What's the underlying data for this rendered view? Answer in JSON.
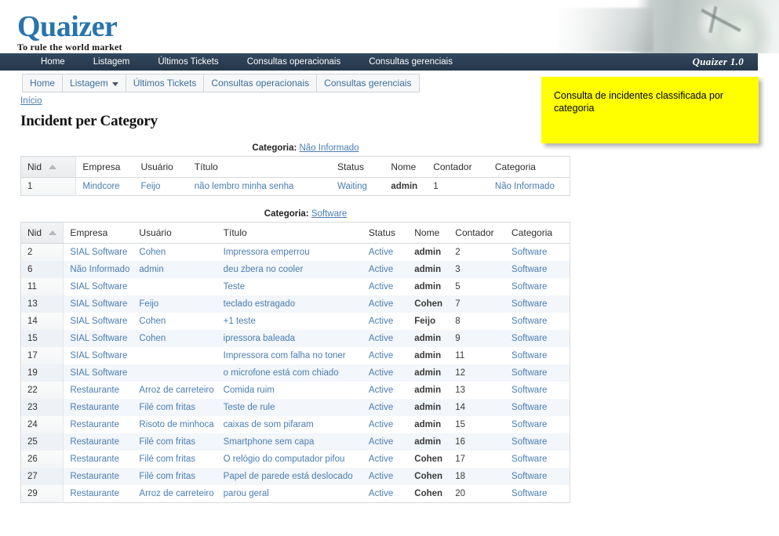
{
  "brand": {
    "logo": "Quaizer",
    "tagline": "To rule the world market",
    "version": "Quaizer 1.0",
    "logo_color": "#2874ab",
    "nav_bg": "#2b3e53"
  },
  "primary_nav": [
    {
      "label": "Home"
    },
    {
      "label": "Listagem"
    },
    {
      "label": "Últimos Tickets"
    },
    {
      "label": "Consultas operacionais"
    },
    {
      "label": "Consultas gerenciais"
    }
  ],
  "secondary_nav": [
    {
      "label": "Home",
      "caret": false
    },
    {
      "label": "Listagem",
      "caret": true
    },
    {
      "label": "Últimos Tickets",
      "caret": false
    },
    {
      "label": "Consultas operacionais",
      "caret": false
    },
    {
      "label": "Consultas gerenciais",
      "caret": false
    }
  ],
  "breadcrumb": "Início",
  "page_title": "Incident per Category",
  "callout": {
    "text": "Consulta de incidentes classificada por categoria",
    "bg": "#ffff00"
  },
  "columns": [
    "Nid",
    "Empresa",
    "Usuário",
    "Título",
    "Status",
    "Nome",
    "Contador",
    "Categoria"
  ],
  "groups": [
    {
      "label_prefix": "Categoria:",
      "label_value": "Não Informado",
      "rows": [
        {
          "nid": "1",
          "empresa": "Mindcore",
          "usuario": "Feijo",
          "titulo": "não lembro minha senha",
          "status": "Waiting",
          "nome": "admin",
          "contador": "1",
          "categoria": "Não Informado"
        }
      ]
    },
    {
      "label_prefix": "Categoria:",
      "label_value": "Software",
      "rows": [
        {
          "nid": "2",
          "empresa": "SIAL Software",
          "usuario": "Cohen",
          "titulo": "Impressora emperrou",
          "status": "Active",
          "nome": "admin",
          "contador": "2",
          "categoria": "Software"
        },
        {
          "nid": "6",
          "empresa": "Não Informado",
          "usuario": "admin",
          "titulo": "deu zbera no cooler",
          "status": "Active",
          "nome": "admin",
          "contador": "3",
          "categoria": "Software"
        },
        {
          "nid": "11",
          "empresa": "SIAL Software",
          "usuario": "",
          "titulo": "Teste",
          "status": "Active",
          "nome": "admin",
          "contador": "5",
          "categoria": "Software"
        },
        {
          "nid": "13",
          "empresa": "SIAL Software",
          "usuario": "Feijo",
          "titulo": "teclado estragado",
          "status": "Active",
          "nome": "Cohen",
          "contador": "7",
          "categoria": "Software"
        },
        {
          "nid": "14",
          "empresa": "SIAL Software",
          "usuario": "Cohen",
          "titulo": "+1 teste",
          "status": "Active",
          "nome": "Feijo",
          "contador": "8",
          "categoria": "Software"
        },
        {
          "nid": "15",
          "empresa": "SIAL Software",
          "usuario": "Cohen",
          "titulo": "ipressora baleada",
          "status": "Active",
          "nome": "admin",
          "contador": "9",
          "categoria": "Software"
        },
        {
          "nid": "17",
          "empresa": "SIAL Software",
          "usuario": "",
          "titulo": "Impressora com falha no toner",
          "status": "Active",
          "nome": "admin",
          "contador": "11",
          "categoria": "Software"
        },
        {
          "nid": "19",
          "empresa": "SIAL Software",
          "usuario": "",
          "titulo": "o microfone está com chiado",
          "status": "Active",
          "nome": "admin",
          "contador": "12",
          "categoria": "Software"
        },
        {
          "nid": "22",
          "empresa": "Restaurante",
          "usuario": "Arroz de carreteiro",
          "titulo": "Comida ruim",
          "status": "Active",
          "nome": "admin",
          "contador": "13",
          "categoria": "Software"
        },
        {
          "nid": "23",
          "empresa": "Restaurante",
          "usuario": "Filé com fritas",
          "titulo": "Teste de rule",
          "status": "Active",
          "nome": "admin",
          "contador": "14",
          "categoria": "Software"
        },
        {
          "nid": "24",
          "empresa": "Restaurante",
          "usuario": "Risoto de minhoca",
          "titulo": "caixas de som pifaram",
          "status": "Active",
          "nome": "admin",
          "contador": "15",
          "categoria": "Software"
        },
        {
          "nid": "25",
          "empresa": "Restaurante",
          "usuario": "Filé com fritas",
          "titulo": "Smartphone sem capa",
          "status": "Active",
          "nome": "admin",
          "contador": "16",
          "categoria": "Software"
        },
        {
          "nid": "26",
          "empresa": "Restaurante",
          "usuario": "Filé com fritas",
          "titulo": "O relógio do computador pifou",
          "status": "Active",
          "nome": "Cohen",
          "contador": "17",
          "categoria": "Software"
        },
        {
          "nid": "27",
          "empresa": "Restaurante",
          "usuario": "Filé com fritas",
          "titulo": "Papel de parede está deslocado",
          "status": "Active",
          "nome": "Cohen",
          "contador": "18",
          "categoria": "Software"
        },
        {
          "nid": "29",
          "empresa": "Restaurante",
          "usuario": "Arroz de carreteiro",
          "titulo": "parou geral",
          "status": "Active",
          "nome": "Cohen",
          "contador": "20",
          "categoria": "Software"
        }
      ]
    }
  ]
}
